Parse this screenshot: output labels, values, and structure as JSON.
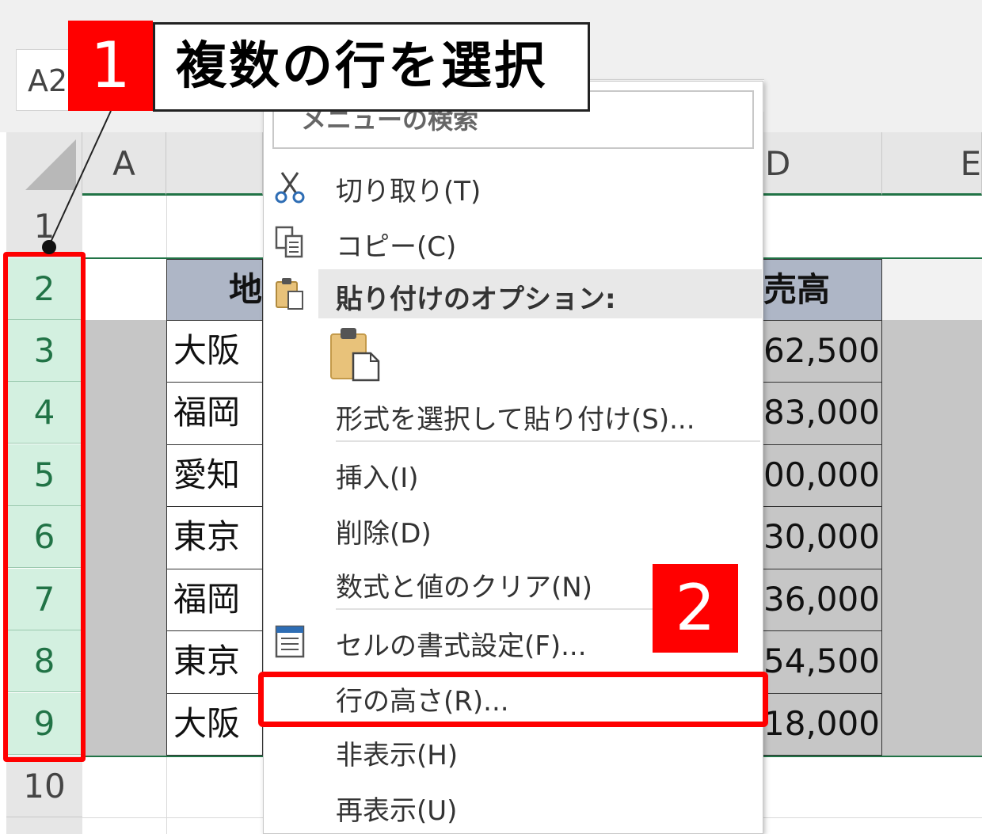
{
  "name_box": "A2",
  "columns": [
    {
      "label": "A"
    },
    {
      "label": "D"
    },
    {
      "label": "E"
    }
  ],
  "rows": [
    "1",
    "2",
    "3",
    "4",
    "5",
    "6",
    "7",
    "8",
    "9",
    "10"
  ],
  "table": {
    "header_left": "地",
    "header_right": "売高",
    "cities": [
      "大阪",
      "福岡",
      "愛知",
      "東京",
      "福岡",
      "東京",
      "大阪"
    ],
    "values": [
      "62,500",
      "83,000",
      "00,000",
      "30,000",
      "36,000",
      "54,500",
      "18,000"
    ]
  },
  "menu": {
    "search_placeholder": "メニューの検索",
    "cut": "切り取り(T)",
    "copy": "コピー(C)",
    "paste_options": "貼り付けのオプション:",
    "paste_special": "形式を選択して貼り付け(S)...",
    "insert": "挿入(I)",
    "delete": "削除(D)",
    "clear": "数式と値のクリア(N)",
    "format_cells": "セルの書式設定(F)...",
    "row_height": "行の高さ(R)...",
    "hide": "非表示(H)",
    "unhide": "再表示(U)"
  },
  "callouts": {
    "step1_number": "1",
    "step1_text": "複数の行を選択",
    "step2_number": "2"
  },
  "colors": {
    "accent_red": "#ff0000",
    "excel_green": "#217346",
    "selected_header": "#d3f0e0",
    "table_header": "#aeb6c6",
    "clipboard": "#e8c27a"
  }
}
